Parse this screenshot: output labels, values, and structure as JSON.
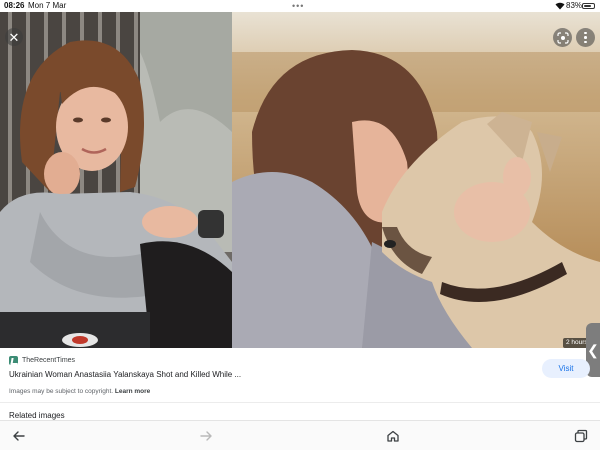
{
  "status_bar": {
    "time": "08:26",
    "date": "Mon 7 Mar",
    "battery_percent": "83%",
    "battery_level": 0.83
  },
  "viewer": {
    "close_icon": "close-icon",
    "lens_icon": "google-lens-icon",
    "more_icon": "more-vertical-icon",
    "time_badge": "2 hours",
    "side_tab_icon": "chevron-left-icon",
    "side_tab_glyph": "❮"
  },
  "result": {
    "source_name": "TheRecentTimes",
    "title": "Ukrainian Woman Anastasiia Yalanskaya Shot and Killed While ...",
    "visit_label": "Visit",
    "copyright_text": "Images may be subject to copyright.",
    "learn_more": "Learn more",
    "related_heading": "Related images"
  },
  "toolbar": {
    "icons": [
      "back-arrow-icon",
      "forward-arrow-icon",
      "home-icon",
      "tabs-icon"
    ]
  },
  "colors": {
    "accent": "#1a73e8",
    "visit_bg": "#e8f0fe",
    "source_logo": "#3c8c75"
  }
}
